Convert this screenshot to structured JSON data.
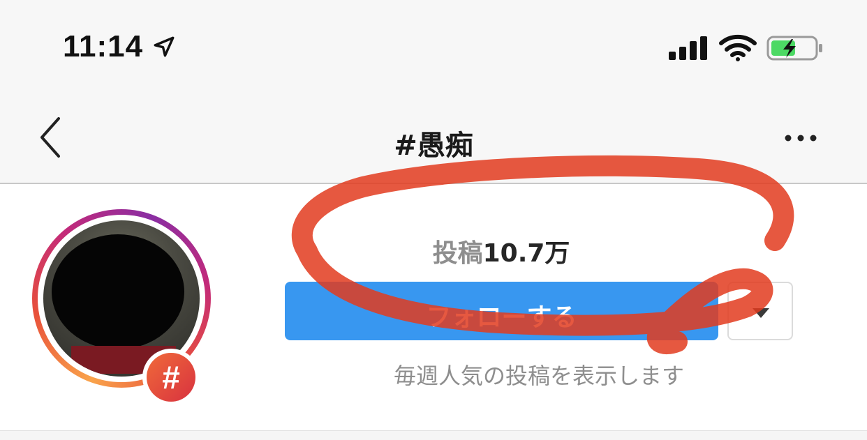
{
  "status_bar": {
    "time": "11:14",
    "location_icon": "location-arrow-icon",
    "signal_icon": "cellular-signal-icon",
    "wifi_icon": "wifi-icon",
    "battery_icon": "battery-charging-icon"
  },
  "nav": {
    "title": "#愚痴",
    "back_icon": "chevron-left-icon",
    "more_icon": "more-dots-icon"
  },
  "hashtag": {
    "badge_symbol": "#",
    "posts_label": "投稿",
    "posts_count": "10.7万",
    "follow_label": "フォローする",
    "weekly_note": "毎週人気の投稿を表示します"
  },
  "colors": {
    "follow_button": "#3897f0",
    "annotation": "#e23b1e",
    "battery_fill": "#4cd964"
  }
}
